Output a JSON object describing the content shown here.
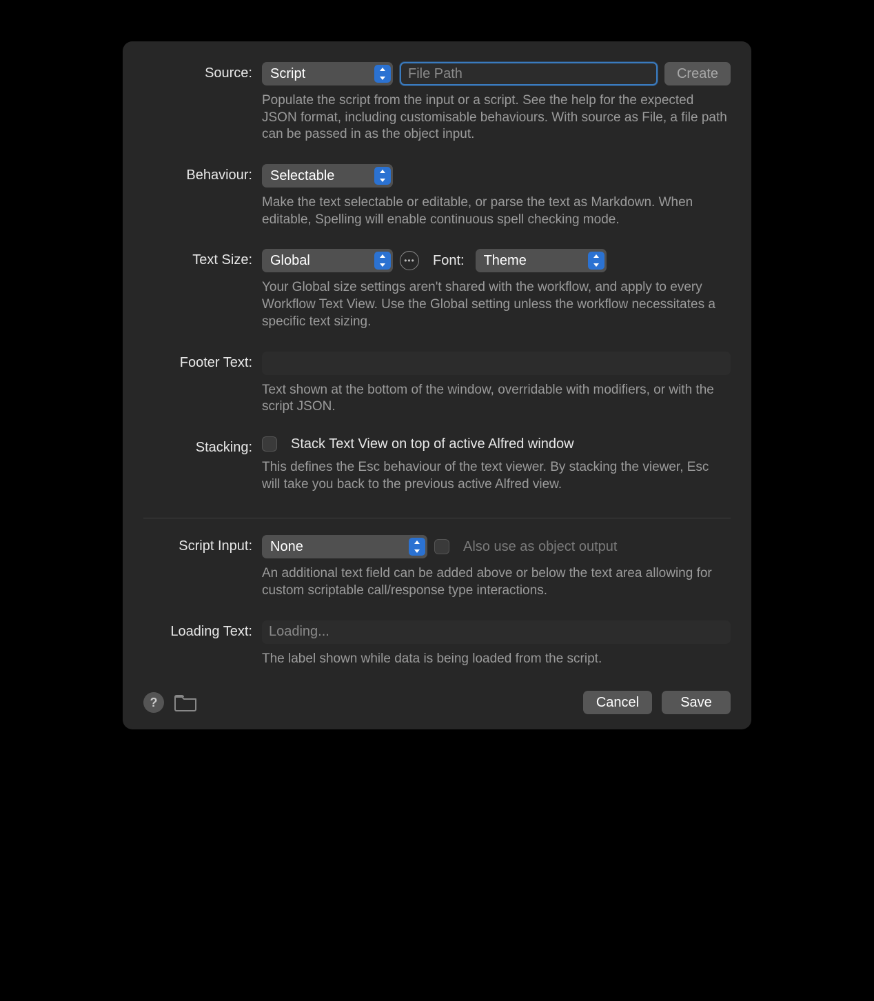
{
  "source": {
    "label": "Source:",
    "select_value": "Script",
    "filepath_placeholder": "File Path",
    "create_label": "Create",
    "help": "Populate the script from the input or a script. See the help for the expected JSON format, including customisable behaviours. With source as File, a file path can be passed in as the object input."
  },
  "behaviour": {
    "label": "Behaviour:",
    "select_value": "Selectable",
    "help": "Make the text selectable or editable, or parse the text as Markdown. When editable, Spelling will enable continuous spell checking mode."
  },
  "textsize": {
    "label": "Text Size:",
    "select_value": "Global",
    "font_label": "Font:",
    "font_select_value": "Theme",
    "help": "Your Global size settings aren't shared with the workflow, and apply to every Workflow Text View. Use the Global setting unless the workflow necessitates a specific text sizing."
  },
  "footertext": {
    "label": "Footer Text:",
    "value": "",
    "help": "Text shown at the bottom of the window, overridable with modifiers, or with the script JSON."
  },
  "stacking": {
    "label": "Stacking:",
    "checkbox_label": "Stack Text View on top of active Alfred window",
    "help": "This defines the Esc behaviour of the text viewer. By stacking the viewer, Esc will take you back to the previous active Alfred view."
  },
  "scriptinput": {
    "label": "Script Input:",
    "select_value": "None",
    "checkbox_label": "Also use as object output",
    "help": "An additional text field can be added above or below the text area allowing for custom scriptable call/response type interactions."
  },
  "loadingtext": {
    "label": "Loading Text:",
    "placeholder": "Loading...",
    "help": "The label shown while data is being loaded from the script."
  },
  "footer": {
    "help_glyph": "?",
    "cancel": "Cancel",
    "save": "Save"
  }
}
